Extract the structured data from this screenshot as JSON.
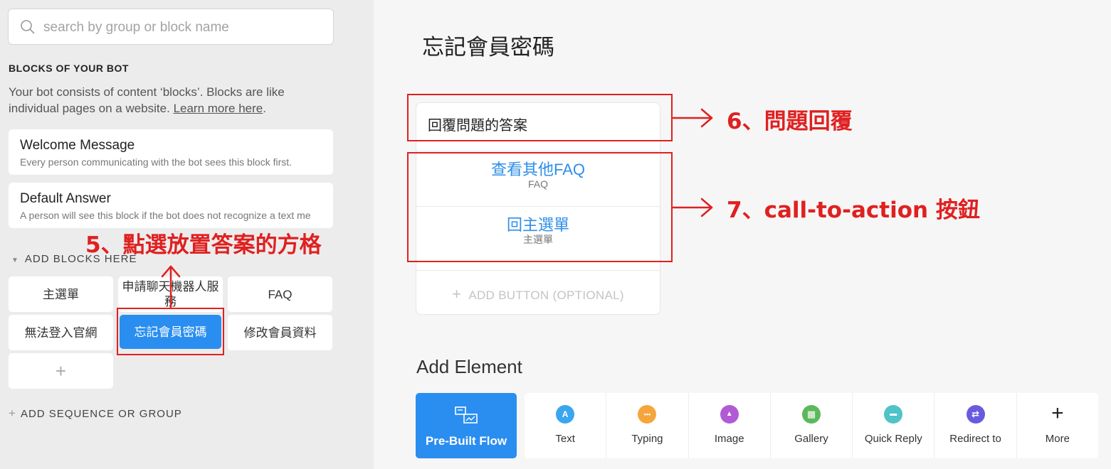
{
  "sidebar": {
    "search_placeholder": "search by group or block name",
    "section_title": "BLOCKS OF YOUR BOT",
    "description": "Your bot consists of content ‘blocks’. Blocks are like individual pages on a website.",
    "learn_more": "Learn more here",
    "welcome": {
      "title": "Welcome Message",
      "subtitle": "Every person communicating with the bot sees this block first."
    },
    "default_answer": {
      "title": "Default Answer",
      "subtitle": "A person will see this block if the bot does not recognize a text me"
    },
    "group_title": "ADD BLOCKS HERE",
    "blocks": [
      "主選單",
      "申請聊天機器人服務",
      "FAQ",
      "無法登入官網",
      "忘記會員密碼",
      "修改會員資料"
    ],
    "add_block": "+",
    "add_sequence": "ADD SEQUENCE OR GROUP"
  },
  "main": {
    "page_title": "忘記會員密碼",
    "message_text": "回覆問題的答案",
    "buttons": [
      {
        "label": "查看其他FAQ",
        "sub": "FAQ"
      },
      {
        "label": "回主選單",
        "sub": "主選單"
      }
    ],
    "add_button": "ADD BUTTON (OPTIONAL)",
    "add_element_title": "Add Element",
    "prebuilt_label": "Pre-Built Flow",
    "tools": [
      {
        "label": "Text",
        "icon": "A",
        "icon_name": "text-icon",
        "color": "#3aa6f0"
      },
      {
        "label": "Typing",
        "icon": "•••",
        "icon_name": "typing-icon",
        "color": "#f4a63c"
      },
      {
        "label": "Image",
        "icon": "▲",
        "icon_name": "image-icon",
        "color": "#b05ad6"
      },
      {
        "label": "Gallery",
        "icon": "▦",
        "icon_name": "gallery-icon",
        "color": "#5cb85c"
      },
      {
        "label": "Quick Reply",
        "icon": "▬",
        "icon_name": "quick-reply-icon",
        "color": "#4fc3c7"
      },
      {
        "label": "Redirect to",
        "icon": "⇄",
        "icon_name": "redirect-icon",
        "color": "#6a5ae0"
      },
      {
        "label": "More",
        "icon": "+",
        "icon_name": "plus-icon",
        "color": ""
      }
    ]
  },
  "annotations": {
    "a5": "5、點選放置答案的方格",
    "a6": "6、問題回覆",
    "a7": "7、call-to-action 按鈕",
    "accent": "#e02020"
  }
}
